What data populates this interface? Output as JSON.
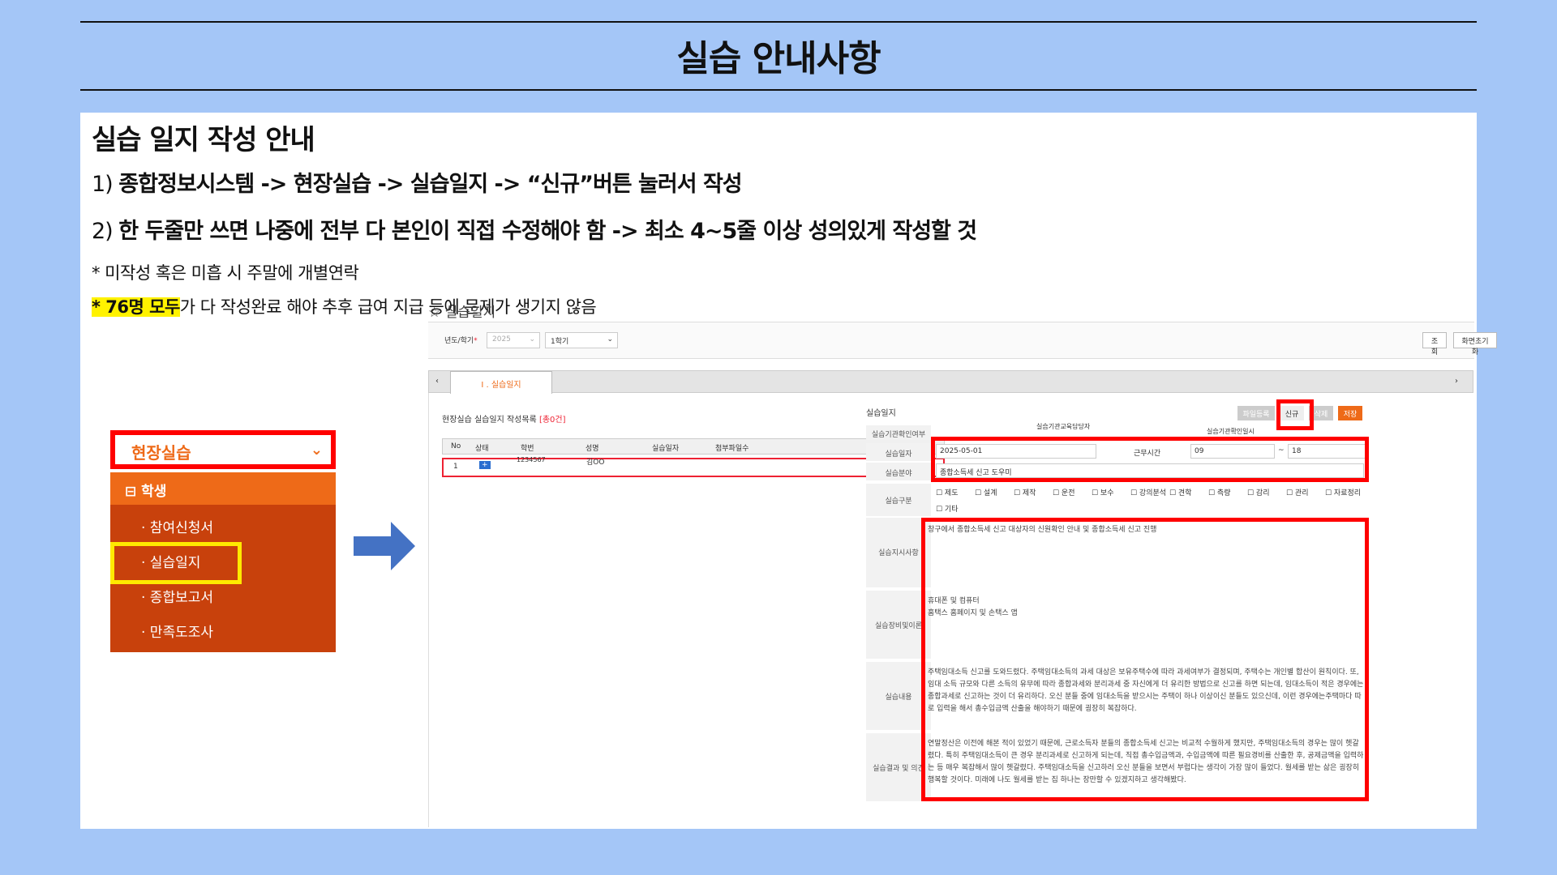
{
  "slide": {
    "title": "실습 안내사항",
    "heading": "실습 일지 작성 안내",
    "line1": {
      "prefix": "1) ",
      "path": "종합정보시스템 -> 현장실습 -> 실습일지 -> “신규”버튼 눌러서 작성"
    },
    "line2": {
      "prefix": "2) ",
      "text": "한 두줄만 쓰면 나중에 전부 다 본인이 직접 수정해야 함 -> 최소 4~5줄 이상 성의있게 작성할 것"
    },
    "note1": "* 미작성 혹은 미흡 시 주말에 개별연락",
    "note2_highlight": "* 76명 모두",
    "note2_rest": "가 다 작성완료 해야 추후 급여 지급 등에 문제가 생기지 않음"
  },
  "menu": {
    "top_label": "현장실습",
    "section": "학생",
    "items": [
      "· 참여신청서",
      "· 실습일지",
      "· 종합보고서",
      "· 만족도조사"
    ]
  },
  "shot": {
    "title": "실습일지",
    "filter": {
      "label": "년도/학기",
      "year": "2025",
      "term": "1학기",
      "btn_search": "조회",
      "btn_reset": "화면초기화"
    },
    "tab": "I . 실습일지",
    "list": {
      "title": "현장실습 실습일지 작성목록",
      "count": "[총0건]",
      "headers": [
        "No",
        "상태",
        "학번",
        "성명",
        "실습일자",
        "첨부파일수"
      ],
      "row": {
        "no": "1",
        "id": "1234567",
        "name": "김OO"
      }
    },
    "form": {
      "title": "실습일지",
      "buttons": [
        "파일등록",
        "신규",
        "삭제",
        "저장"
      ],
      "label_confirm": "실습기관확인여부",
      "label_manager": "실습기관교육담당자",
      "label_confirm_date": "실습기관확인일시",
      "label_date": "실습일자",
      "date": "2025-05-01",
      "label_time": "근무시간",
      "time_from": "09",
      "time_sep": "~",
      "time_to": "18",
      "label_field": "실습분야",
      "field": "종합소득세 신고 도우미",
      "label_type": "실습구분",
      "types": [
        "제도",
        "설계",
        "제작",
        "운전",
        "보수",
        "강의분석",
        "견학",
        "측량",
        "감리",
        "관리",
        "자료정리",
        "기타"
      ],
      "label_instr": "실습지시사항",
      "instr": "창구에서 종합소득세 신고 대상자의 신원확인 안내 및 종합소득세 신고 진행",
      "label_equip": "실습장비및이론",
      "equip": [
        "휴대폰 및 컴퓨터",
        "홈택스 홈페이지 및 손택스 앱"
      ],
      "label_content": "실습내용",
      "content": "주택임대소득 신고를 도와드렸다. 주택임대소득의 과세 대상은 보유주택수에 따라 과세여부가 결정되며, 주택수는 개인별 합산이 원칙이다. 또, 임대 소득 규모와 다른 소득의 유무에 따라 종합과세와 분리과세 중 자신에게 더 유리한 방법으로 신고를 하면 되는데, 임대소득이 적은 경우에는 종합과세로 신고하는 것이 더 유리하다. 오신 분들 중에 임대소득을 받으시는 주택이 하나 이상이신 분들도 있으신데, 이런 경우에는주택마다 따로 입력을 해서 총수입금액 산출을 해야하기 때문에 굉장히 복잡하다.",
      "label_result": "실습결과 및 의견",
      "result": "연말정산은 이전에 해본 적이 있었기 때문에, 근로소득자 분들의 종합소득세 신고는 비교적 수월하게 했지만, 주택임대소득의 경우는 많이 헷갈렸다. 특히 주택임대소득이 큰 경우 분리과세로 신고하게 되는데, 직접 총수입금액과, 수입금액에 따른 필요경비를 산출한 후, 공제금액을 입력하는 등 매우 복잡해서 많이 헷갈렸다. 주택임대소득을 신고하러 오신 분들을 보면서 부럽다는 생각이 가장 많이 들었다. 월세를 받는 삶은 굉장히 행복할 것이다. 미래에 나도 월세를 받는 집 하나는 장만할 수 있겠지하고 생각해봤다."
    }
  }
}
